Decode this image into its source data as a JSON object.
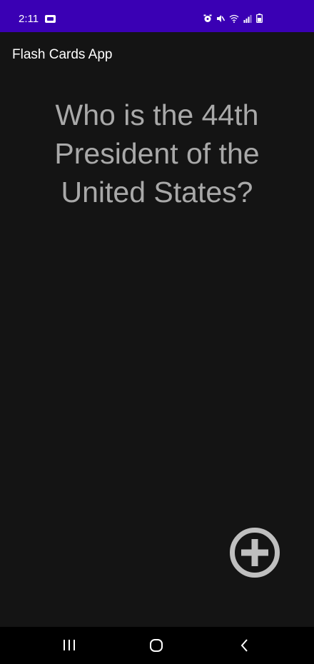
{
  "status_bar": {
    "time": "2:11",
    "background": "#3a00b4",
    "icons": [
      "notification-icon",
      "alarm-icon",
      "mute-icon",
      "wifi-icon",
      "signal-icon",
      "battery-icon"
    ]
  },
  "app_bar": {
    "title": "Flash Cards App"
  },
  "card": {
    "question": "Who is the 44th President of the United States?"
  },
  "fab": {
    "icon": "plus-circle-icon",
    "color": "#bfbfbf"
  },
  "nav_bar": {
    "buttons": [
      "recent-apps-icon",
      "home-icon",
      "back-icon"
    ]
  },
  "colors": {
    "background": "#141414",
    "question_text": "#a9a9a9",
    "title_text": "#ffffff"
  }
}
